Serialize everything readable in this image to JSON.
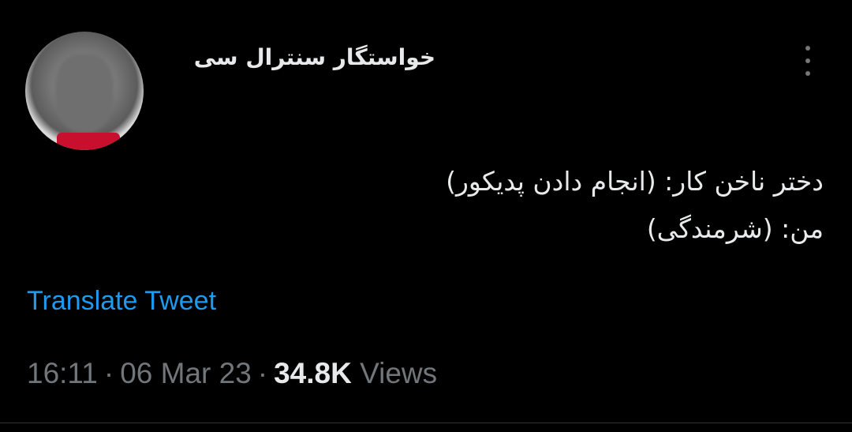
{
  "tweet": {
    "author": {
      "display_name": "خواستگار سنترال سی",
      "avatar_icon": "user-avatar-icon"
    },
    "more_icon": "more-vertical-icon",
    "text_lines": [
      "دختر ناخن کار: (انجام دادن پدیکور)",
      "من: (شرمندگی)"
    ],
    "translate_label": "Translate Tweet",
    "time": "16:11",
    "date": "06 Mar 23",
    "separator": "·",
    "views_count": "34.8K",
    "views_label": "Views"
  },
  "colors": {
    "background": "#000000",
    "text_primary": "#e7e9ea",
    "text_secondary": "#71767b",
    "link": "#1d9bf0"
  }
}
